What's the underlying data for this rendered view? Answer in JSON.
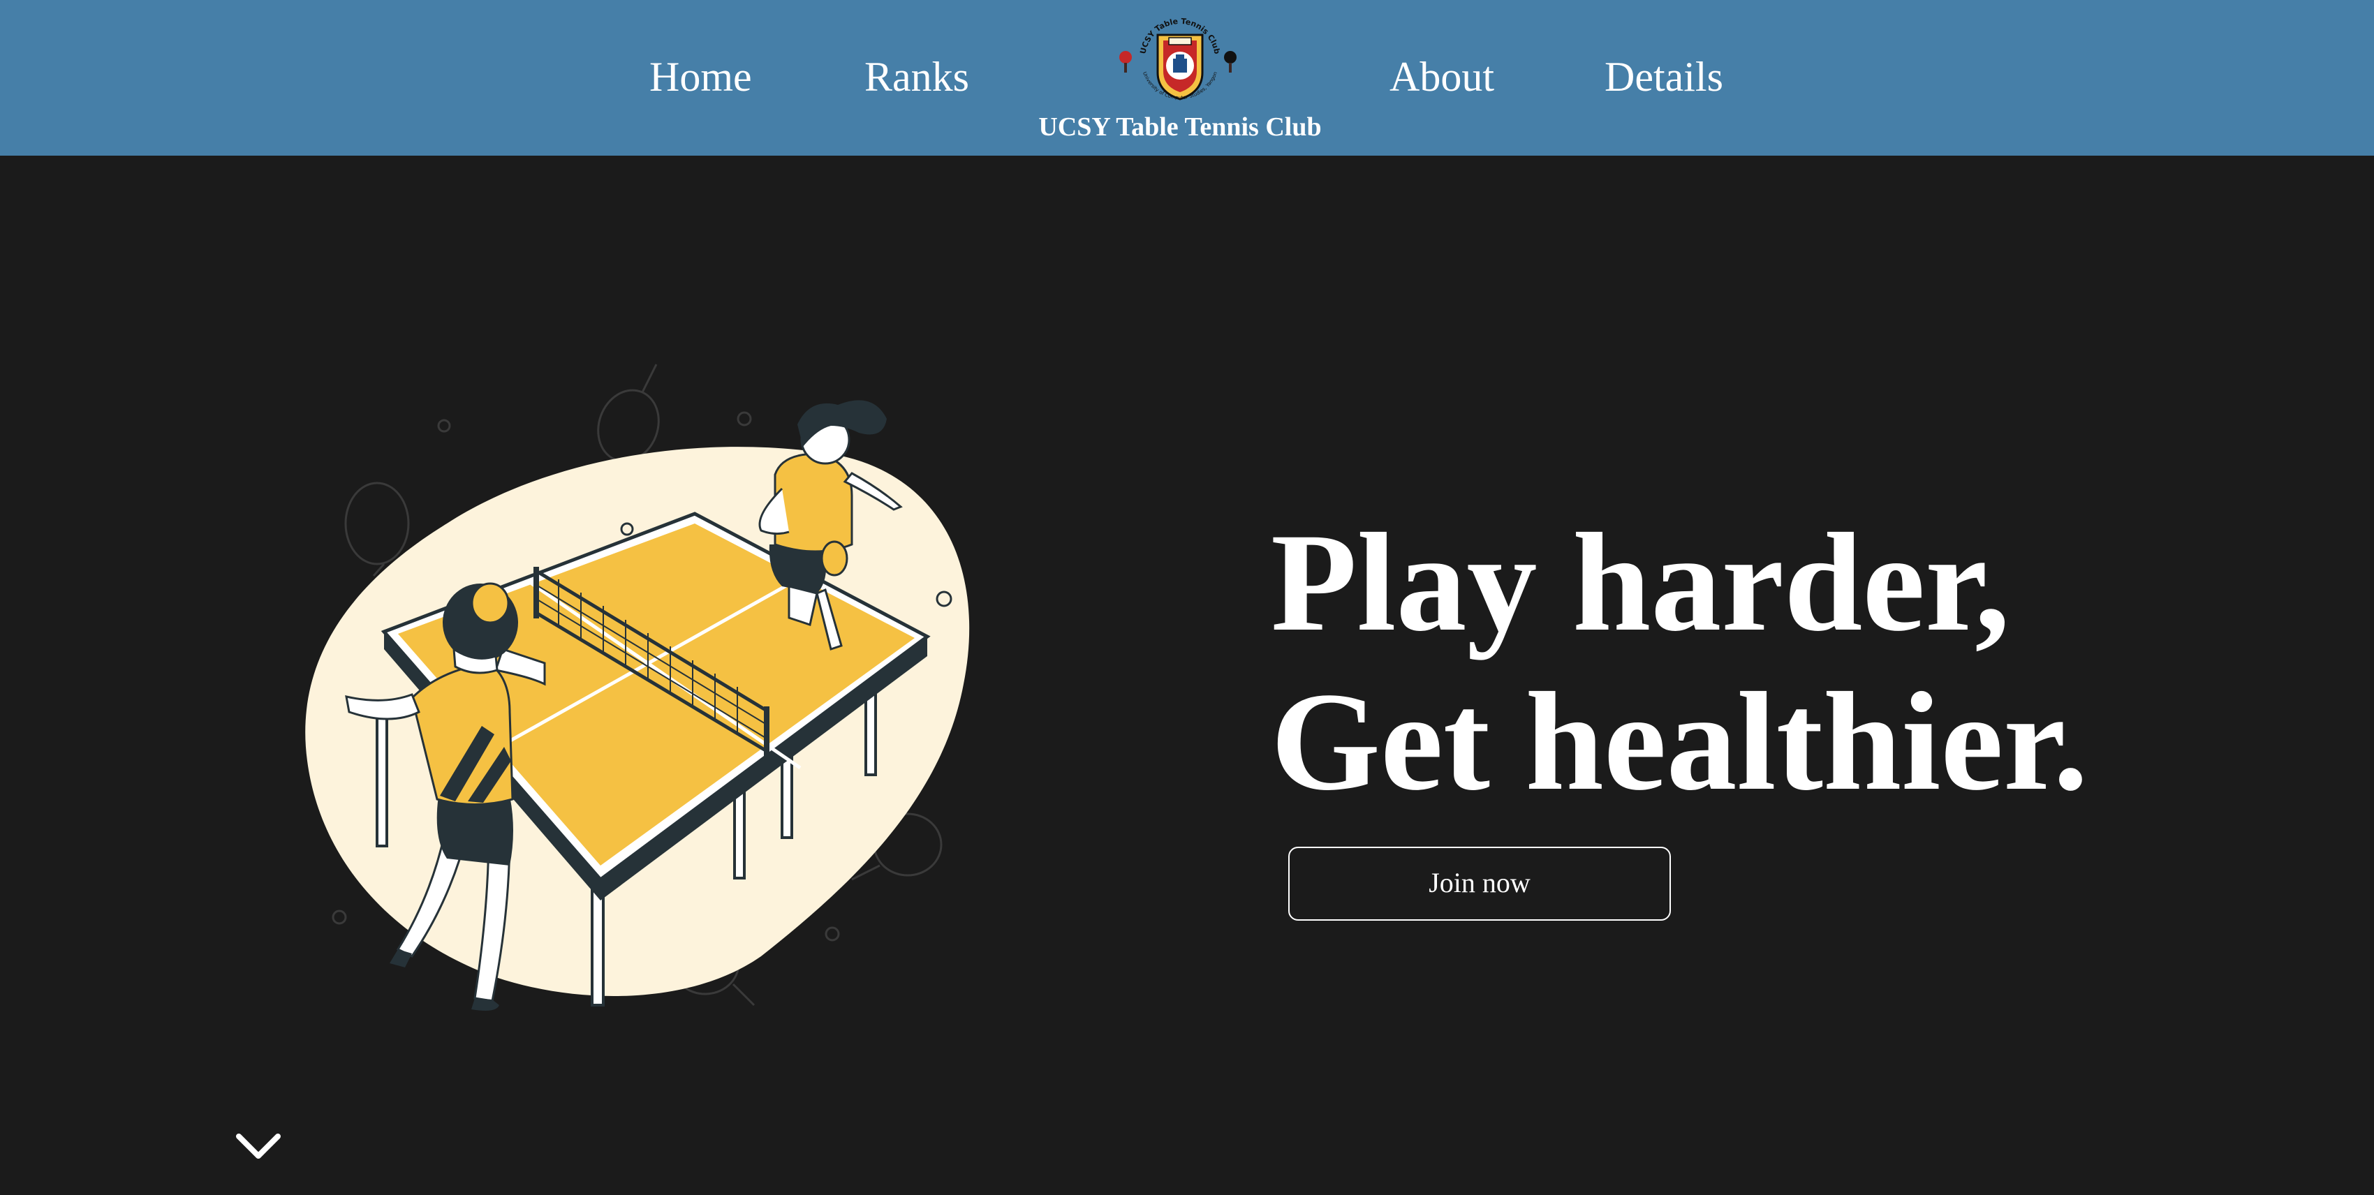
{
  "nav": {
    "home": "Home",
    "ranks": "Ranks",
    "about": "About",
    "details": "Details",
    "brand_name": "UCSY Table Tennis Club",
    "logo_top_text": "UCSY Table Tennis Club",
    "logo_bottom_text": "University of Computer Studies, Yangon"
  },
  "hero": {
    "headline_line1": "Play harder,",
    "headline_line2": "Get healthier.",
    "cta_label": "Join now"
  },
  "icons": {
    "scroll": "chevron-down-icon",
    "logo": "club-logo-icon",
    "illustration": "table-tennis-illustration"
  },
  "colors": {
    "navbar": "#467fa8",
    "background": "#1b1b1b",
    "accent_yellow": "#f5c143",
    "blob_cream": "#fdf3dc",
    "dark": "#263238"
  }
}
